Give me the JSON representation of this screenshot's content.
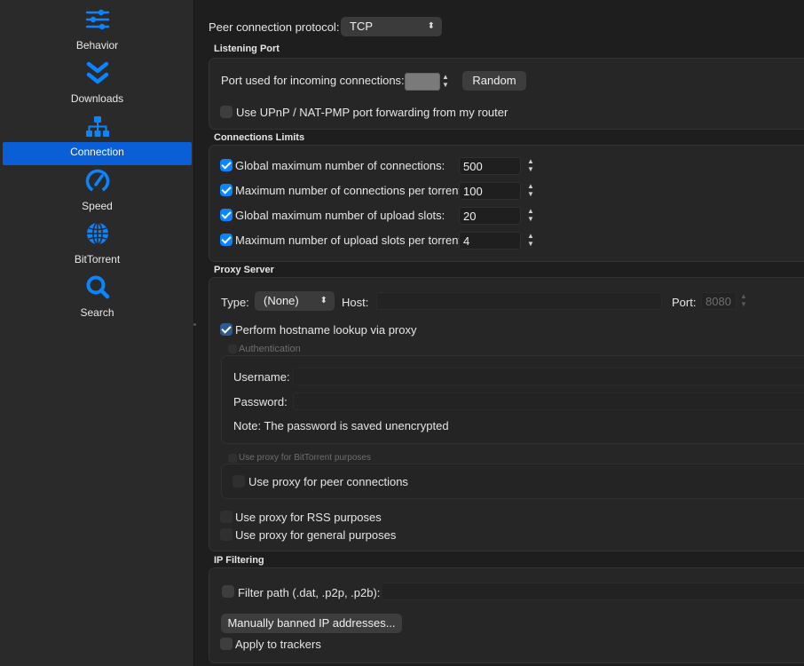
{
  "sidebar": {
    "items": [
      {
        "label": "Behavior",
        "icon": "sliders-icon"
      },
      {
        "label": "Downloads",
        "icon": "double-chevron-down-icon"
      },
      {
        "label": "Connection",
        "icon": "network-icon"
      },
      {
        "label": "Speed",
        "icon": "speedometer-icon"
      },
      {
        "label": "BitTorrent",
        "icon": "globe-icon"
      },
      {
        "label": "Search",
        "icon": "magnifier-icon"
      }
    ],
    "active_index": 2,
    "accent": "#0a84ff",
    "selection_color": "#0a5fd6"
  },
  "protocol": {
    "label": "Peer connection protocol:",
    "value": "TCP"
  },
  "listening": {
    "title": "Listening Port",
    "port_label": "Port used for incoming connections:",
    "random_button": "Random",
    "upnp_label": "Use UPnP / NAT-PMP port forwarding from my router",
    "upnp_checked": false
  },
  "limits": {
    "title": "Connections Limits",
    "rows": [
      {
        "label": "Global maximum number of connections:",
        "value": "500",
        "checked": true
      },
      {
        "label": "Maximum number of connections per torrent:",
        "value": "100",
        "checked": true
      },
      {
        "label": "Global maximum number of upload slots:",
        "value": "20",
        "checked": true
      },
      {
        "label": "Maximum number of upload slots per torrent:",
        "value": "4",
        "checked": true
      }
    ]
  },
  "proxy": {
    "title": "Proxy Server",
    "type_label": "Type:",
    "type_value": "(None)",
    "host_label": "Host:",
    "host_value": "",
    "port_label": "Port:",
    "port_value": "8080",
    "hostname_lookup_label": "Perform hostname lookup via proxy",
    "auth_title": "Authentication",
    "username_label": "Username:",
    "password_label": "Password:",
    "note": "Note: The password is saved unencrypted",
    "bittorrent_title": "Use proxy for BitTorrent purposes",
    "peer_label": "Use proxy for peer connections",
    "rss_label": "Use proxy for RSS purposes",
    "general_label": "Use proxy for general purposes"
  },
  "ipfilter": {
    "title": "IP Filtering",
    "filter_label": "Filter path (.dat, .p2p, .p2b):",
    "banned_button": "Manually banned IP addresses...",
    "trackers_label": "Apply to trackers"
  }
}
